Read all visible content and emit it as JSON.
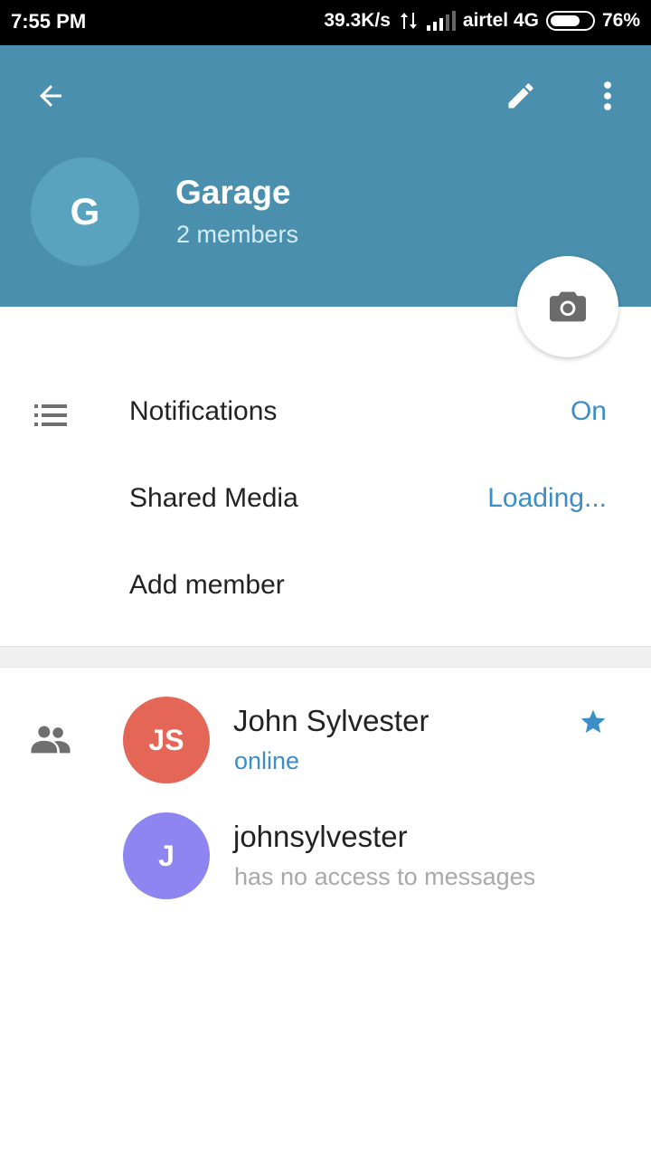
{
  "status_bar": {
    "time": "7:55 PM",
    "speed": "39.3K/s",
    "carrier": "airtel 4G",
    "battery": "76%",
    "battery_level": 0.76
  },
  "header": {
    "group_initial": "G",
    "group_name": "Garage",
    "members_count": "2 members",
    "background_color": "#4a90ae"
  },
  "settings": {
    "notifications_label": "Notifications",
    "notifications_value": "On",
    "shared_media_label": "Shared Media",
    "shared_media_value": "Loading...",
    "add_member_label": "Add member"
  },
  "members": [
    {
      "initials": "JS",
      "name": "John Sylvester",
      "status": "online",
      "avatar_color": "#e46656",
      "status_color": "#3b8ec6"
    },
    {
      "initials": "J",
      "name": "johnsylvester",
      "status": "has no access to messages",
      "avatar_color": "#8e85f0",
      "status_color": "#a9a9a9"
    }
  ],
  "icons": {
    "back": "arrow-left-icon",
    "edit": "pencil-icon",
    "more": "more-vertical-icon",
    "camera": "camera-icon",
    "notifications": "list-icon",
    "members": "group-icon",
    "admin": "star-icon"
  }
}
